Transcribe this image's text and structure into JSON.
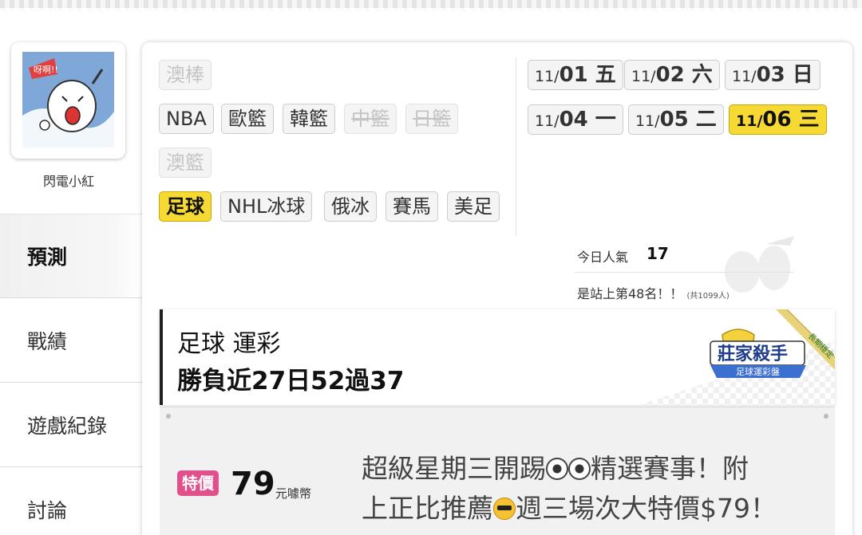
{
  "user": {
    "name": "閃電小紅",
    "avatar_text": "呀啊!!"
  },
  "menu": [
    {
      "label": "預測",
      "active": true
    },
    {
      "label": "戰績",
      "active": false
    },
    {
      "label": "遊戲紀錄",
      "active": false
    },
    {
      "label": "討論",
      "active": false
    }
  ],
  "sports": {
    "row0": [
      "澳棒"
    ],
    "row1": [
      "NBA",
      "歐籃",
      "韓籃",
      "中籃",
      "日籃"
    ],
    "row2": [
      "澳籃"
    ],
    "row3": [
      "足球",
      "NHL冰球",
      "俄冰",
      "賽馬",
      "美足"
    ]
  },
  "dates": [
    {
      "month": "11/",
      "day": "01 五"
    },
    {
      "month": "11/",
      "day": "02 六"
    },
    {
      "month": "11/",
      "day": "03 日"
    },
    {
      "month": "11/",
      "day": "04 一"
    },
    {
      "month": "11/",
      "day": "05 二"
    },
    {
      "month": "11/",
      "day": "06 三"
    }
  ],
  "popularity": {
    "label": "今日人氣",
    "value": "17",
    "rank": "是站上第48名！！",
    "total": "(共1099人)"
  },
  "header": {
    "title": "足球 運彩",
    "record": "勝負近27日52過37"
  },
  "badge": {
    "title": "莊家殺手",
    "subtitle": "足球運彩盤",
    "ribbon": "長期穩定"
  },
  "offer": {
    "sale_label": "特價",
    "price": "79",
    "currency": "元噱幣",
    "line1_a": "超級星期三開踢",
    "line1_b": "精選賽事！附",
    "line2_a": "上正比推薦",
    "line2_b": "週三場次大特價$79！"
  },
  "colors": {
    "active_yellow": "#f7d934",
    "sale_pink": "#e2508c"
  }
}
